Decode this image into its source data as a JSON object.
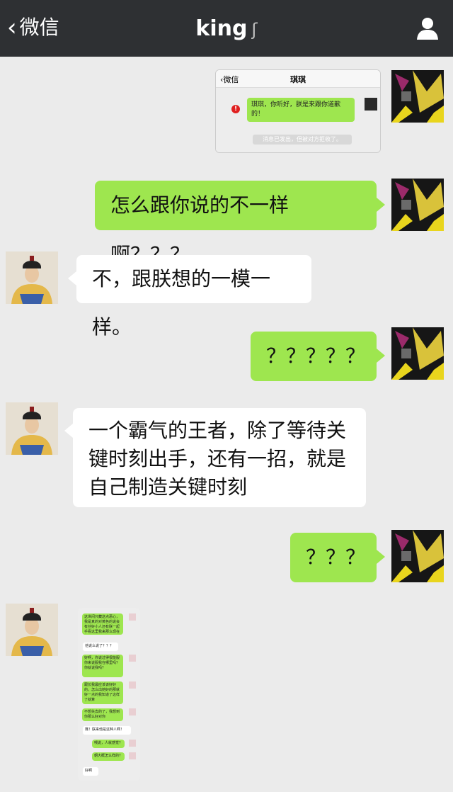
{
  "header": {
    "back_label": "微信",
    "title": "king",
    "ear_glyph": "ʃ"
  },
  "embedded_top": {
    "header_back": "微信",
    "header_title": "琪琪",
    "message": "琪琪，你听好，朕是来跟你道歉的！",
    "notice": "消息已发出，但被对方拒收了。"
  },
  "messages": [
    {
      "side": "right",
      "text": "怎么跟你说的不一样啊？？？"
    },
    {
      "side": "left",
      "text": "不，跟朕想的一模一样。"
    },
    {
      "side": "right",
      "text": "？？？？？"
    },
    {
      "side": "left",
      "lines": [
        "一个霸气的王者，除了等待关",
        "键时刻出手，还有一招，就是",
        "自己制造关键时刻"
      ]
    },
    {
      "side": "right",
      "text": "？？？"
    }
  ],
  "embedded_bottom": {
    "msgs": [
      "这世间只藏这点恶心，我是真的对黄色的说会有丝好小人还有朕一起手看这里我来那么现在",
      "他说么说了？？？",
      "好啊，你说过得很能服你来说服我在哪里吗？你就说我吗？",
      "跟长我最应该该好好的，怎么出她好的那就好一点的我知道了这样了就算",
      "不想失去的了，我想到你那么好对你",
      "赛！朕来他是这种人啊！",
      "喂说，人就感觉？",
      "朝大概怎么样的？",
      "好啊"
    ]
  },
  "colors": {
    "topbar": "#2e3033",
    "background": "#ebebeb",
    "bubble_green": "#9ee64f",
    "bubble_white": "#ffffff"
  }
}
